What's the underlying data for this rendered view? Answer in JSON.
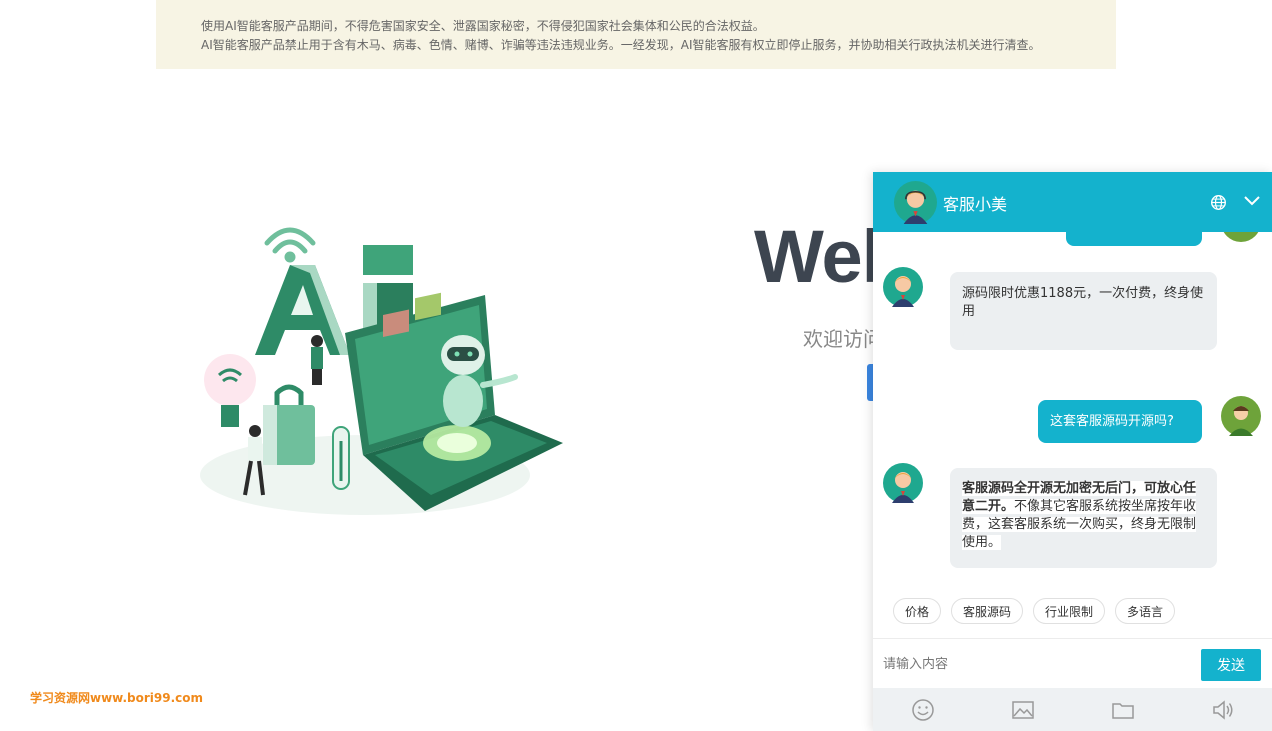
{
  "notice": {
    "line1": "使用AI智能客服产品期间，不得危害国家安全、泄露国家秘密，不得侵犯国家社会集体和公民的合法权益。",
    "line2": "AI智能客服产品禁止用于含有木马、病毒、色情、赌博、诈骗等违法违规业务。一经发现，AI智能客服有权立即停止服务，并协助相关行政执法机关进行清查。"
  },
  "hero": {
    "title": "Wel",
    "subtitle": "欢迎访问"
  },
  "watermark": "学习资源网www.bori99.com",
  "chat": {
    "agent_name": "客服小美",
    "messages": [
      {
        "from": "agent",
        "text": "源码限时优惠1188元，一次付费，终身使用"
      },
      {
        "from": "user",
        "text": "这套客服源码开源吗?"
      },
      {
        "from": "agent",
        "bold": "客服源码全开源无加密无后门，可放心任意二开。",
        "text": "不像其它客服系统按坐席按年收费，这套客服系统一次购买，终身无限制使用。"
      }
    ],
    "quick_replies": [
      "价格",
      "客服源码",
      "行业限制",
      "多语言"
    ],
    "input_placeholder": "请输入内容",
    "send_label": "发送"
  },
  "colors": {
    "accent": "#14b2cd",
    "notice_bg": "#f7f4e4",
    "bubble_agent": "#eceff1",
    "watermark": "#f08a1c"
  }
}
